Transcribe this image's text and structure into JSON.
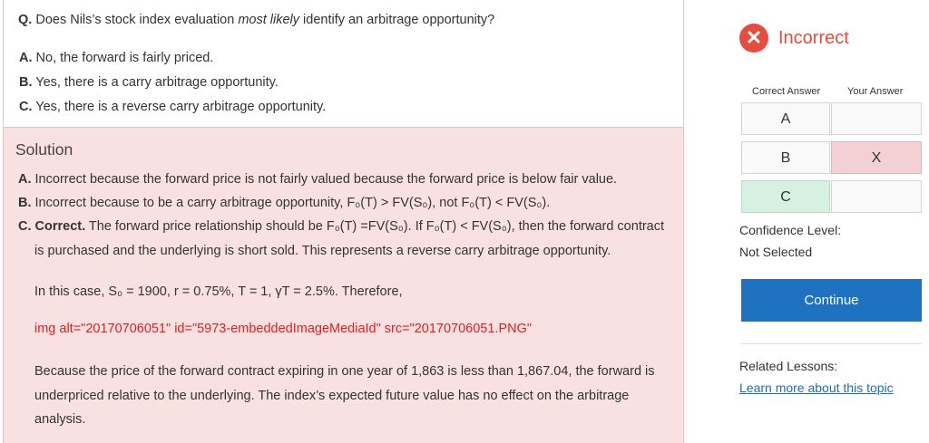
{
  "question": {
    "prefix": "Q.",
    "text_before": "Does Nils’s stock index evaluation ",
    "text_emph": "most likely",
    "text_after": " identify an arbitrage opportunity?",
    "options": [
      {
        "letter": "A.",
        "text": "No, the forward is fairly priced."
      },
      {
        "letter": "B.",
        "text": "Yes, there is a carry arbitrage opportunity."
      },
      {
        "letter": "C.",
        "text": "Yes, there is a reverse carry arbitrage opportunity."
      }
    ]
  },
  "solution": {
    "title": "Solution",
    "a_letter": "A.",
    "a_text": "Incorrect because the forward price is not fairly valued because the forward price is below fair value.",
    "b_letter": "B.",
    "b_text": "Incorrect because to be a carry arbitrage opportunity, F₀(T) > FV(S₀), not F₀(T) < FV(S₀).",
    "c_letter": "C. Correct.",
    "c_text": "The forward price relationship should be F₀(T) =FV(S₀). If F₀(T) < FV(S₀), then the forward contract",
    "c_text2": "is purchased and the underlying is short sold. This represents a reverse carry arbitrage opportunity.",
    "case_text": "In this case, S₀ = 1900, r = 0.75%, T = 1, γT = 2.5%. Therefore,",
    "img_text": "img alt=\"20170706051\" id=\"5973-embeddedImageMediaId\" src=\"20170706051.PNG\"",
    "because_1": "Because the price of the forward contract expiring in one year of 1,863 is less than 1,867.04, the forward is",
    "because_2": "underpriced relative to the underlying. The index’s expected future value has no effect on the arbitrage",
    "because_3": "analysis."
  },
  "result": {
    "icon": "x-circle-icon",
    "status": "Incorrect",
    "correct_header": "Correct Answer",
    "your_header": "Your Answer",
    "rows": [
      {
        "correct": "A",
        "yours": ""
      },
      {
        "correct": "B",
        "yours": "X"
      },
      {
        "correct": "C",
        "yours": ""
      }
    ],
    "confidence_label": "Confidence Level:",
    "confidence_value": "Not Selected",
    "continue_label": "Continue",
    "related_label": "Related Lessons:",
    "related_link": "Learn more about this topic"
  },
  "colors": {
    "incorrect_red": "#e74c3c",
    "solution_bg": "#f9e1e1",
    "correct_green": "#d6f0e2",
    "wrong_pink": "#f2d0d4",
    "continue_blue": "#1f72c0",
    "link_blue": "#1a6ec0"
  }
}
